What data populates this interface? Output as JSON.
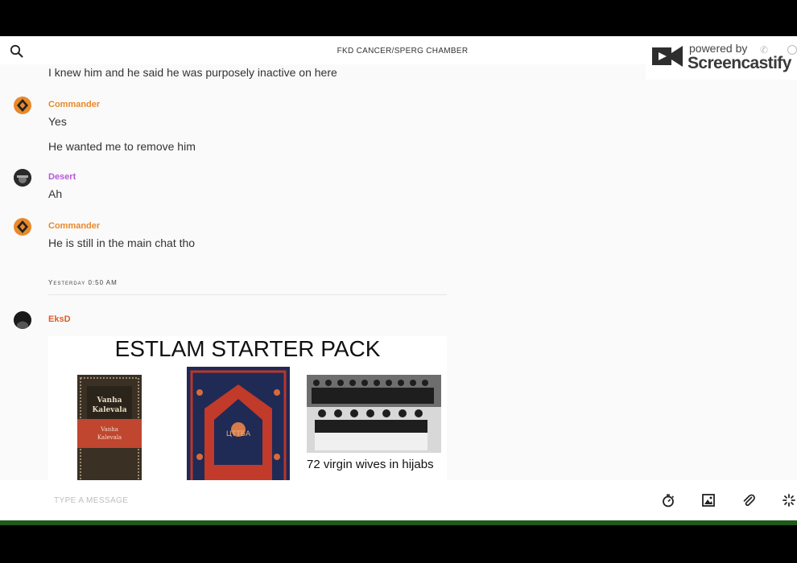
{
  "header": {
    "title": "FKD CANCER/SPERG CHAMBER"
  },
  "watermark": {
    "powered_by": "powered by",
    "brand": "Screencastify"
  },
  "messages": {
    "m0": {
      "text": "I knew him and he said he was purposely inactive on here"
    },
    "m1": {
      "author": "Commander",
      "author_color": "#e8892a",
      "lines": [
        "Yes",
        "He wanted me to remove him"
      ]
    },
    "m2": {
      "author": "Desert",
      "author_color": "#b35bd6",
      "lines": [
        "Ah"
      ]
    },
    "m3": {
      "author": "Commander",
      "author_color": "#e8892a",
      "lines": [
        "He is still in the main chat tho"
      ]
    },
    "divider": "Yesterday 0:50 AM",
    "m4": {
      "author": "EksD",
      "author_color": "#e05a2a",
      "image": {
        "title": "ESTLAM STARTER PACK",
        "caption": "72 virgin wives in hijabs",
        "book_text": [
          "Vanha Kalevala",
          "Vanha Kalevala"
        ],
        "rug_text": "ЦТТБА"
      }
    }
  },
  "composer": {
    "placeholder": "TYPE A MESSAGE",
    "tools": [
      "timer-icon",
      "image-icon",
      "attachment-icon",
      "sparkle-icon"
    ]
  }
}
